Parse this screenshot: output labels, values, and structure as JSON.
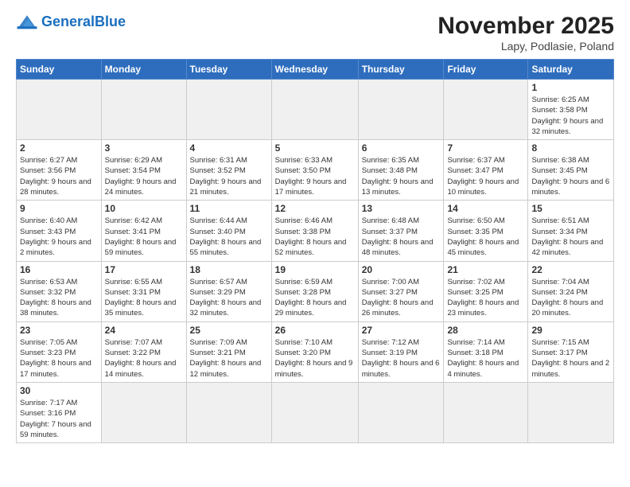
{
  "header": {
    "logo_general": "General",
    "logo_blue": "Blue",
    "month_title": "November 2025",
    "location": "Lapy, Podlasie, Poland"
  },
  "weekdays": [
    "Sunday",
    "Monday",
    "Tuesday",
    "Wednesday",
    "Thursday",
    "Friday",
    "Saturday"
  ],
  "weeks": [
    [
      {
        "day": "",
        "info": "",
        "empty": true
      },
      {
        "day": "",
        "info": "",
        "empty": true
      },
      {
        "day": "",
        "info": "",
        "empty": true
      },
      {
        "day": "",
        "info": "",
        "empty": true
      },
      {
        "day": "",
        "info": "",
        "empty": true
      },
      {
        "day": "",
        "info": "",
        "empty": true
      },
      {
        "day": "1",
        "info": "Sunrise: 6:25 AM\nSunset: 3:58 PM\nDaylight: 9 hours\nand 32 minutes.",
        "empty": false
      }
    ],
    [
      {
        "day": "2",
        "info": "Sunrise: 6:27 AM\nSunset: 3:56 PM\nDaylight: 9 hours\nand 28 minutes.",
        "empty": false
      },
      {
        "day": "3",
        "info": "Sunrise: 6:29 AM\nSunset: 3:54 PM\nDaylight: 9 hours\nand 24 minutes.",
        "empty": false
      },
      {
        "day": "4",
        "info": "Sunrise: 6:31 AM\nSunset: 3:52 PM\nDaylight: 9 hours\nand 21 minutes.",
        "empty": false
      },
      {
        "day": "5",
        "info": "Sunrise: 6:33 AM\nSunset: 3:50 PM\nDaylight: 9 hours\nand 17 minutes.",
        "empty": false
      },
      {
        "day": "6",
        "info": "Sunrise: 6:35 AM\nSunset: 3:48 PM\nDaylight: 9 hours\nand 13 minutes.",
        "empty": false
      },
      {
        "day": "7",
        "info": "Sunrise: 6:37 AM\nSunset: 3:47 PM\nDaylight: 9 hours\nand 10 minutes.",
        "empty": false
      },
      {
        "day": "8",
        "info": "Sunrise: 6:38 AM\nSunset: 3:45 PM\nDaylight: 9 hours\nand 6 minutes.",
        "empty": false
      }
    ],
    [
      {
        "day": "9",
        "info": "Sunrise: 6:40 AM\nSunset: 3:43 PM\nDaylight: 9 hours\nand 2 minutes.",
        "empty": false
      },
      {
        "day": "10",
        "info": "Sunrise: 6:42 AM\nSunset: 3:41 PM\nDaylight: 8 hours\nand 59 minutes.",
        "empty": false
      },
      {
        "day": "11",
        "info": "Sunrise: 6:44 AM\nSunset: 3:40 PM\nDaylight: 8 hours\nand 55 minutes.",
        "empty": false
      },
      {
        "day": "12",
        "info": "Sunrise: 6:46 AM\nSunset: 3:38 PM\nDaylight: 8 hours\nand 52 minutes.",
        "empty": false
      },
      {
        "day": "13",
        "info": "Sunrise: 6:48 AM\nSunset: 3:37 PM\nDaylight: 8 hours\nand 48 minutes.",
        "empty": false
      },
      {
        "day": "14",
        "info": "Sunrise: 6:50 AM\nSunset: 3:35 PM\nDaylight: 8 hours\nand 45 minutes.",
        "empty": false
      },
      {
        "day": "15",
        "info": "Sunrise: 6:51 AM\nSunset: 3:34 PM\nDaylight: 8 hours\nand 42 minutes.",
        "empty": false
      }
    ],
    [
      {
        "day": "16",
        "info": "Sunrise: 6:53 AM\nSunset: 3:32 PM\nDaylight: 8 hours\nand 38 minutes.",
        "empty": false
      },
      {
        "day": "17",
        "info": "Sunrise: 6:55 AM\nSunset: 3:31 PM\nDaylight: 8 hours\nand 35 minutes.",
        "empty": false
      },
      {
        "day": "18",
        "info": "Sunrise: 6:57 AM\nSunset: 3:29 PM\nDaylight: 8 hours\nand 32 minutes.",
        "empty": false
      },
      {
        "day": "19",
        "info": "Sunrise: 6:59 AM\nSunset: 3:28 PM\nDaylight: 8 hours\nand 29 minutes.",
        "empty": false
      },
      {
        "day": "20",
        "info": "Sunrise: 7:00 AM\nSunset: 3:27 PM\nDaylight: 8 hours\nand 26 minutes.",
        "empty": false
      },
      {
        "day": "21",
        "info": "Sunrise: 7:02 AM\nSunset: 3:25 PM\nDaylight: 8 hours\nand 23 minutes.",
        "empty": false
      },
      {
        "day": "22",
        "info": "Sunrise: 7:04 AM\nSunset: 3:24 PM\nDaylight: 8 hours\nand 20 minutes.",
        "empty": false
      }
    ],
    [
      {
        "day": "23",
        "info": "Sunrise: 7:05 AM\nSunset: 3:23 PM\nDaylight: 8 hours\nand 17 minutes.",
        "empty": false
      },
      {
        "day": "24",
        "info": "Sunrise: 7:07 AM\nSunset: 3:22 PM\nDaylight: 8 hours\nand 14 minutes.",
        "empty": false
      },
      {
        "day": "25",
        "info": "Sunrise: 7:09 AM\nSunset: 3:21 PM\nDaylight: 8 hours\nand 12 minutes.",
        "empty": false
      },
      {
        "day": "26",
        "info": "Sunrise: 7:10 AM\nSunset: 3:20 PM\nDaylight: 8 hours\nand 9 minutes.",
        "empty": false
      },
      {
        "day": "27",
        "info": "Sunrise: 7:12 AM\nSunset: 3:19 PM\nDaylight: 8 hours\nand 6 minutes.",
        "empty": false
      },
      {
        "day": "28",
        "info": "Sunrise: 7:14 AM\nSunset: 3:18 PM\nDaylight: 8 hours\nand 4 minutes.",
        "empty": false
      },
      {
        "day": "29",
        "info": "Sunrise: 7:15 AM\nSunset: 3:17 PM\nDaylight: 8 hours\nand 2 minutes.",
        "empty": false
      }
    ],
    [
      {
        "day": "30",
        "info": "Sunrise: 7:17 AM\nSunset: 3:16 PM\nDaylight: 7 hours\nand 59 minutes.",
        "empty": false
      },
      {
        "day": "",
        "info": "",
        "empty": true
      },
      {
        "day": "",
        "info": "",
        "empty": true
      },
      {
        "day": "",
        "info": "",
        "empty": true
      },
      {
        "day": "",
        "info": "",
        "empty": true
      },
      {
        "day": "",
        "info": "",
        "empty": true
      },
      {
        "day": "",
        "info": "",
        "empty": true
      }
    ]
  ]
}
